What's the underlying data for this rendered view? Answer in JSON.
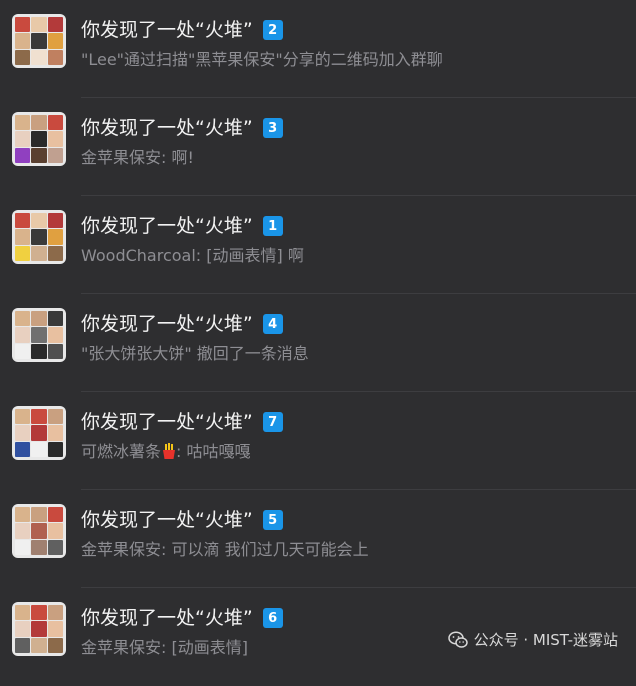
{
  "chats": [
    {
      "title": "你发现了一处“火堆”",
      "badge": "2",
      "preview": "\"Lee\"通过扫描\"黑苹果保安\"分享的二维码加入群聊",
      "has_emoji": false
    },
    {
      "title": "你发现了一处“火堆”",
      "badge": "3",
      "preview": "金苹果保安: 啊!",
      "has_emoji": false
    },
    {
      "title": "你发现了一处“火堆”",
      "badge": "1",
      "preview": "WoodCharcoal: [动画表情] 啊",
      "has_emoji": false
    },
    {
      "title": "你发现了一处“火堆”",
      "badge": "4",
      "preview": "\"张大饼张大饼\" 撤回了一条消息",
      "has_emoji": false
    },
    {
      "title": "你发现了一处“火堆”",
      "badge": "7",
      "preview_before": "可燃冰薯条",
      "preview_after": ": 咕咕嘎嘎",
      "has_emoji": true,
      "emoji_name": "fries-emoji"
    },
    {
      "title": "你发现了一处“火堆”",
      "badge": "5",
      "preview": "金苹果保安: 可以滴 我们过几天可能会上",
      "has_emoji": false
    },
    {
      "title": "你发现了一处“火堆”",
      "badge": "6",
      "preview": "金苹果保安: [动画表情]",
      "has_emoji": false
    }
  ],
  "watermark": {
    "text": "公众号 · MIST-迷雾站",
    "icon": "wechat-icon"
  },
  "colors": {
    "background": "#2e2e30",
    "badge": "#1a95e8",
    "title": "#f2f2f2",
    "preview": "#8e8e93"
  }
}
